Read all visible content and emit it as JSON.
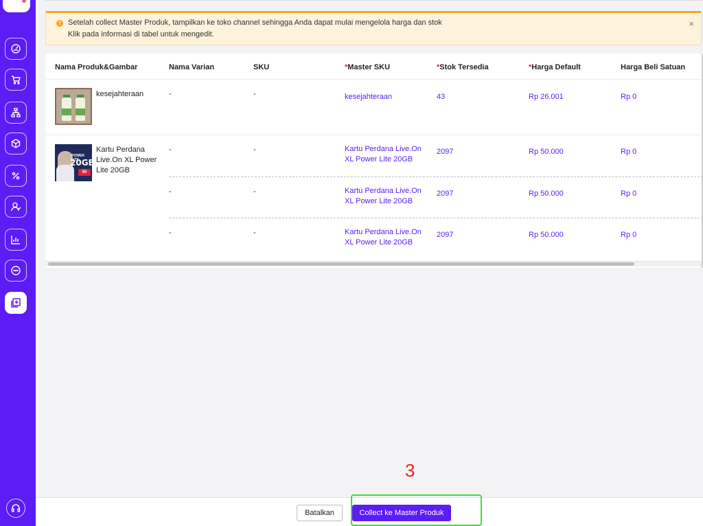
{
  "banner": {
    "line1": "Setelah collect Master Produk, tampilkan ke toko channel sehingga Anda dapat mulai mengelola harga dan stok",
    "line2": "Klik pada informasi di tabel untuk mengedit.",
    "close": "×",
    "warn_icon": "!"
  },
  "table": {
    "headers": {
      "product": "Nama Produk&Gambar",
      "variant": "Nama Varian",
      "sku": "SKU",
      "master_sku": "Master SKU",
      "stock": "Stok Tersedia",
      "price": "Harga Default",
      "buy_price": "Harga Beli Satuan",
      "required_mark": "*"
    },
    "rows": [
      {
        "product_name": "kesejahteraan",
        "variants": [
          {
            "variant": "-",
            "sku": "-",
            "master_sku": "kesejahteraan",
            "stock": "43",
            "price": "Rp 26.001",
            "buy_price": "Rp 0"
          }
        ]
      },
      {
        "product_name": "Kartu Perdana Live.On XL Power Lite 20GB",
        "image_text": {
          "promo": "POWER LITE",
          "gb": "20GB",
          "badge": "50"
        },
        "variants": [
          {
            "variant": "-",
            "sku": "-",
            "master_sku": "Kartu Perdana Live.On XL Power Lite 20GB",
            "stock": "2097",
            "price": "Rp 50.000",
            "buy_price": "Rp 0"
          },
          {
            "variant": "-",
            "sku": "-",
            "master_sku": "Kartu Perdana Live.On XL Power Lite 20GB",
            "stock": "2097",
            "price": "Rp 50.000",
            "buy_price": "Rp 0"
          },
          {
            "variant": "-",
            "sku": "-",
            "master_sku": "Kartu Perdana Live.On XL Power Lite 20GB",
            "stock": "2097",
            "price": "Rp 50.000",
            "buy_price": "Rp 0"
          }
        ]
      }
    ]
  },
  "footer": {
    "cancel_label": "Batalkan",
    "collect_label": "Collect ke Master Produk"
  },
  "annotation": {
    "step": "3"
  },
  "sidebar": {
    "items": [
      "dashboard-icon",
      "cart-icon",
      "hierarchy-icon",
      "box-icon",
      "percent-icon",
      "customer-icon",
      "chart-icon",
      "chat-icon",
      "add-product-icon"
    ],
    "active": "add-product-icon",
    "bottom": "headset-icon"
  },
  "colors": {
    "accent": "#5b1cf5",
    "warning": "#f6a823",
    "required": "#e0233a",
    "highlight": "#3edc3e",
    "step": "#e8221c"
  }
}
